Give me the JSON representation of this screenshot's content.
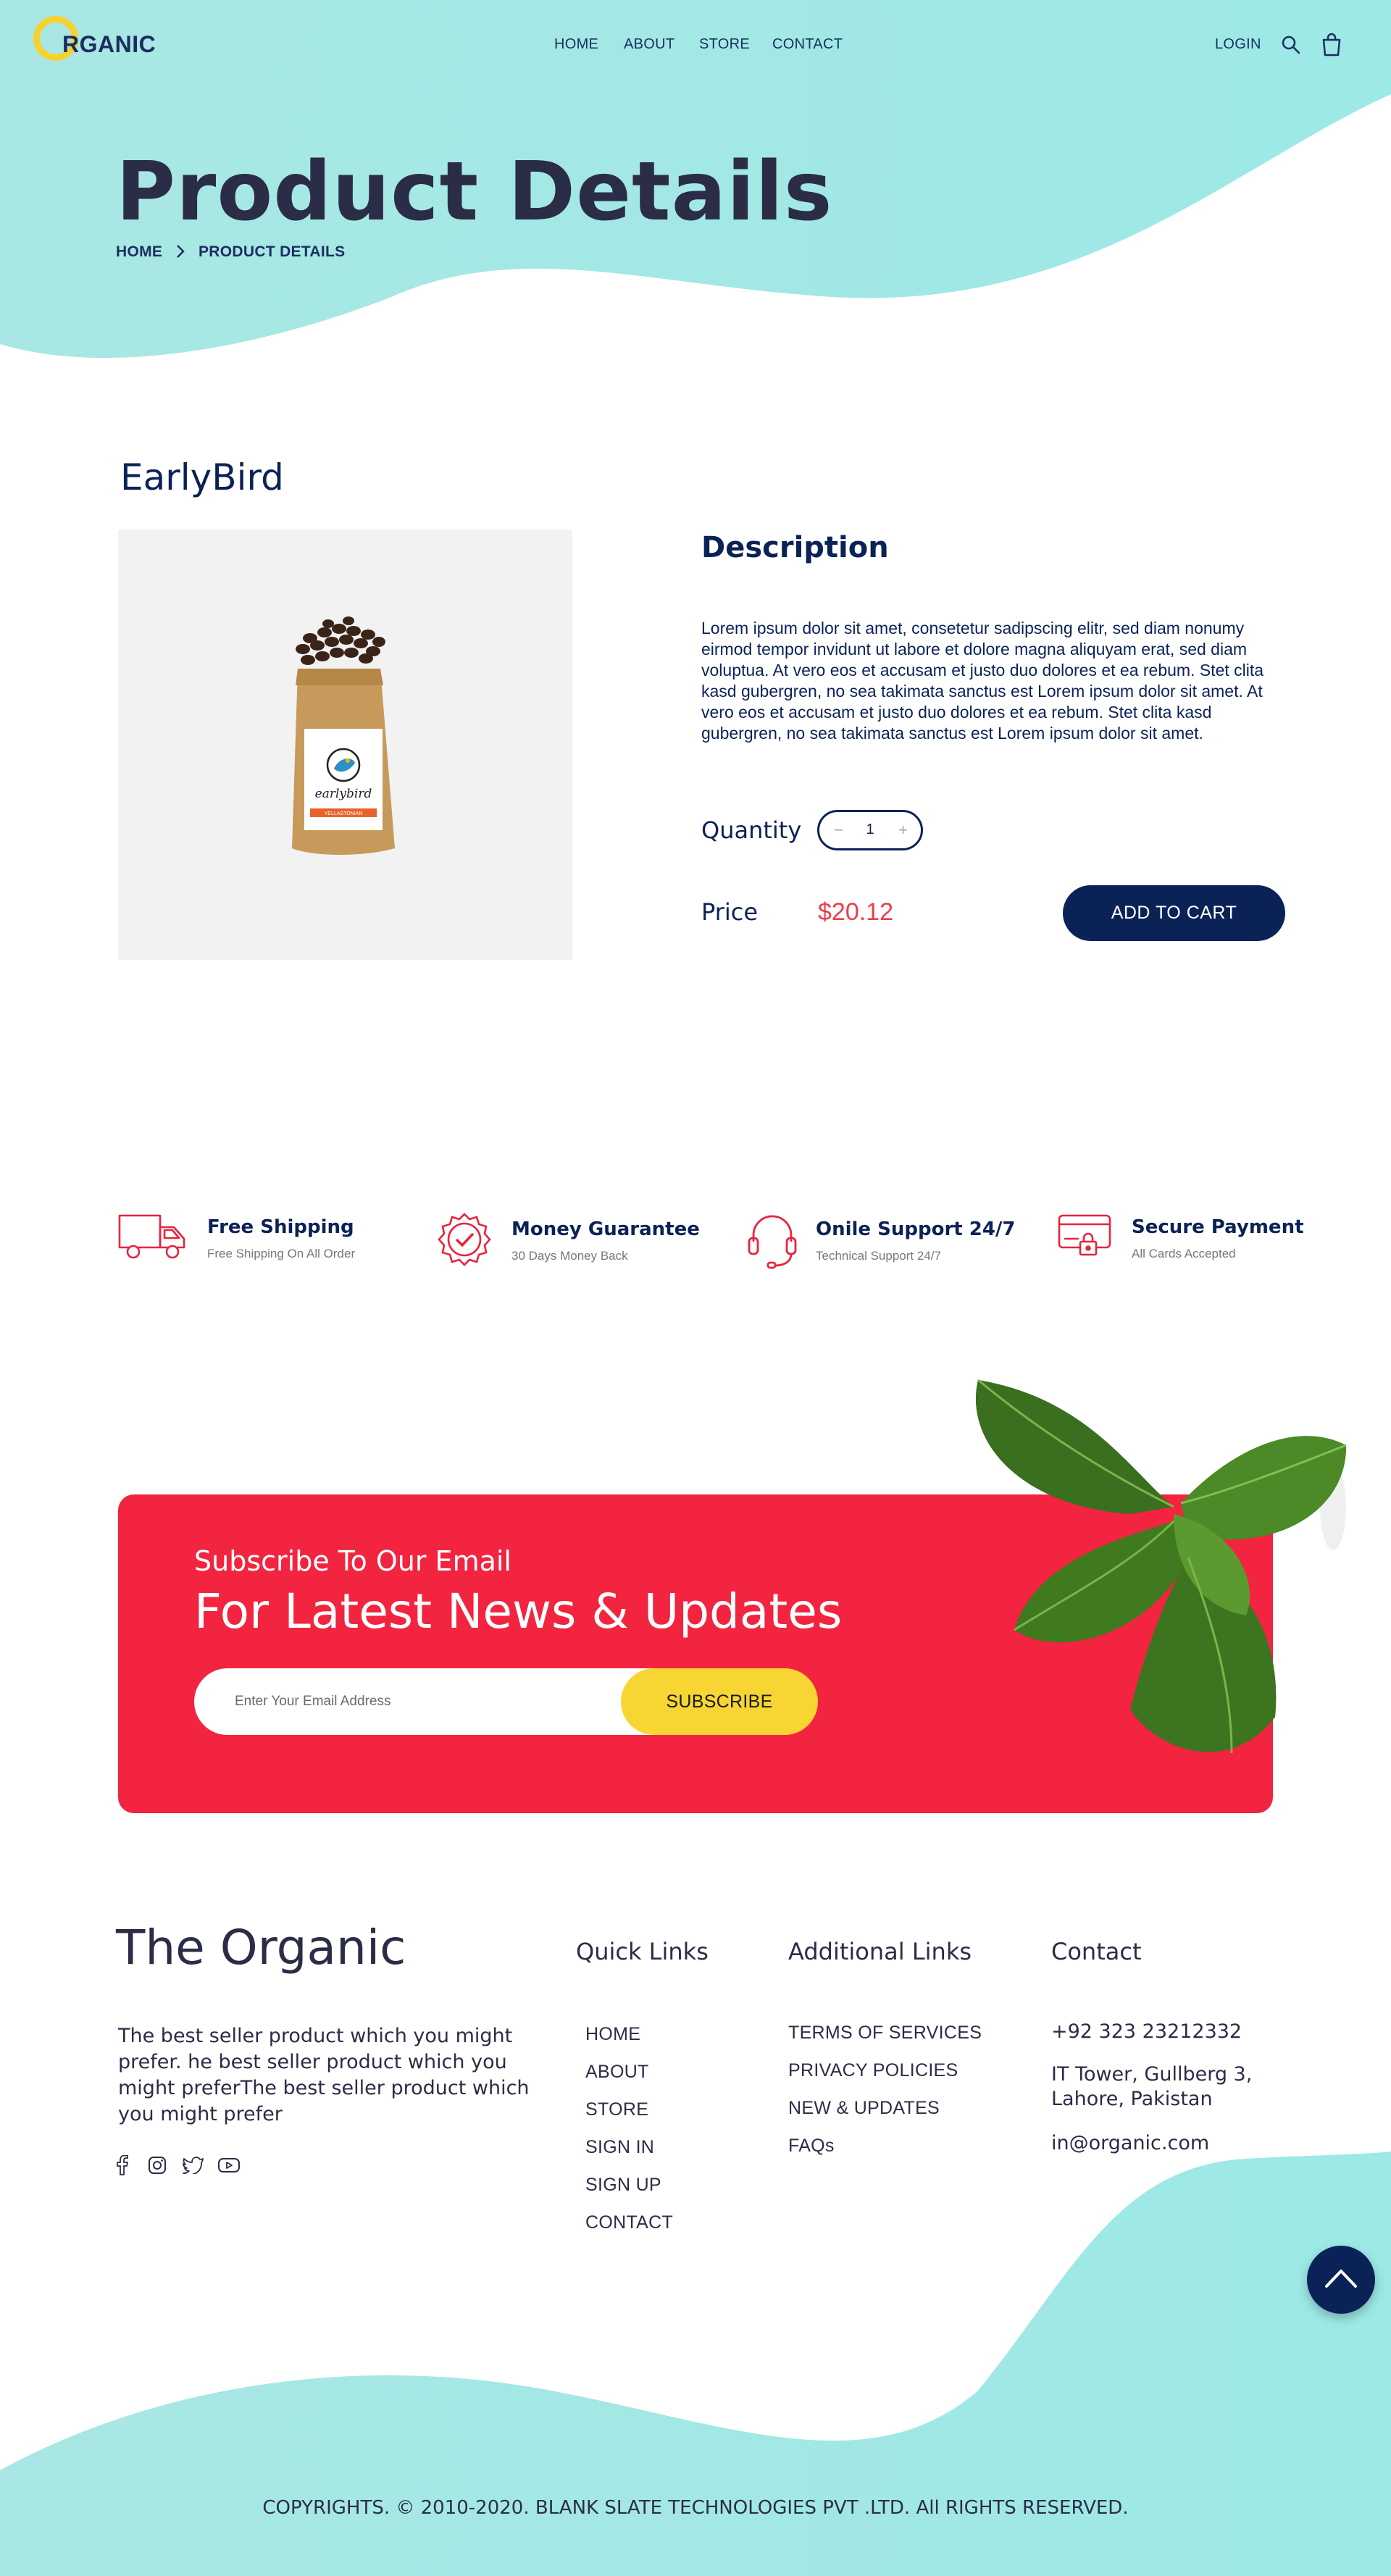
{
  "header": {
    "logo_text": "RGANIC",
    "nav": [
      "HOME",
      "ABOUT",
      "STORE",
      "CONTACT"
    ],
    "login_label": "LOGIN"
  },
  "hero": {
    "title": "Product Details",
    "breadcrumb": [
      "HOME",
      "PRODUCT DETAILS"
    ]
  },
  "product": {
    "name": "EarlyBird",
    "description_title": "Description",
    "description": "Lorem ipsum dolor sit amet, consetetur sadipscing elitr, sed diam nonumy eirmod tempor invidunt ut labore et dolore magna aliquyam erat, sed diam voluptua. At vero eos et accusam et justo duo dolores et ea rebum. Stet clita kasd gubergren, no sea takimata sanctus est Lorem ipsum dolor sit amet. At vero eos et accusam et justo duo dolores et ea rebum. Stet clita kasd gubergren, no sea takimata sanctus est Lorem ipsum dolor sit amet.",
    "quantity_label": "Quantity",
    "quantity_value": "1",
    "minus": "−",
    "plus": "+",
    "price_label": "Price",
    "price": "$20.12",
    "add_to_cart": "ADD TO CART",
    "package_brand": "earlybird",
    "package_band": "YELLASTONIAN"
  },
  "features": [
    {
      "title": "Free Shipping",
      "subtitle": "Free Shipping On All Order",
      "icon": "truck-icon"
    },
    {
      "title": "Money Guarantee",
      "subtitle": "30 Days Money Back",
      "icon": "badge-check-icon"
    },
    {
      "title": "Onile Support 24/7",
      "subtitle": "Technical Support 24/7",
      "icon": "headset-icon"
    },
    {
      "title": "Secure Payment",
      "subtitle": "All Cards Accepted",
      "icon": "secure-card-icon"
    }
  ],
  "subscribe": {
    "small": "Subscribe To Our Email",
    "big": "For Latest News & Updates",
    "placeholder": "Enter Your Email Address",
    "button": "SUBSCRIBE"
  },
  "footer": {
    "brand": "The Organic",
    "description": "The best seller product which you might prefer. he best seller product which you might preferThe best seller product which you might prefer",
    "quick_links_title": "Quick Links",
    "quick_links": [
      "HOME",
      "ABOUT",
      "STORE",
      "SIGN IN",
      "SIGN UP",
      "CONTACT"
    ],
    "additional_title": "Additional Links",
    "additional_links": [
      "TERMS OF SERVICES",
      "PRIVACY POLICIES",
      "NEW & UPDATES",
      "FAQs"
    ],
    "contact_title": "Contact",
    "phone": "+92 323 23212332",
    "address": "IT Tower, Gullberg 3, Lahore, Pakistan",
    "email": "in@organic.com",
    "copyright": "COPYRIGHTS. © 2010-2020. BLANK SLATE TECHNOLOGIES PVT .LTD. All RIGHTS RESERVED."
  },
  "colors": {
    "teal": "#a5e9e6",
    "navy": "#0b2257",
    "red": "#f2243f",
    "yellow": "#f7d633",
    "price_red": "#ef3d4a"
  }
}
